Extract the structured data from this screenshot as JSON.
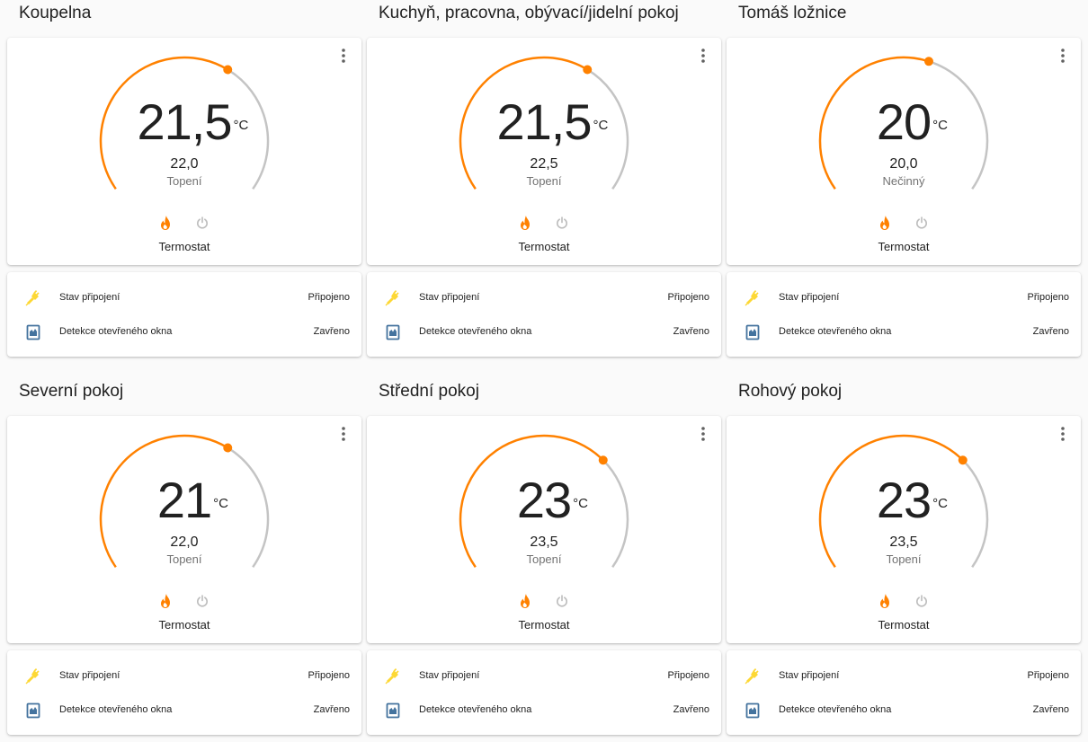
{
  "colors": {
    "heat": "#ff8100",
    "arc_inactive": "#c4c4c4",
    "plug_icon": "#fdd835",
    "window_icon": "#44739e",
    "off_icon": "#bdbdbd"
  },
  "icons": {
    "menu": "dots-vertical-icon",
    "heat": "fire-icon",
    "off": "power-icon",
    "connection": "plug-icon",
    "window": "window-closed-icon"
  },
  "rooms": [
    {
      "title": "Koupelna",
      "current": "21,5",
      "unit": "°C",
      "target": "22,0",
      "action": "Topení",
      "name": "Termostat",
      "gauge_fraction": 0.625,
      "entities": [
        {
          "label": "Stav připojení",
          "value": "Připojeno"
        },
        {
          "label": "Detekce otevřeného okna",
          "value": "Zavřeno"
        }
      ]
    },
    {
      "title": "Kuchyň, pracovna, obývací/jidelní pokoj",
      "current": "21,5",
      "unit": "°C",
      "target": "22,5",
      "action": "Topení",
      "name": "Termostat",
      "gauge_fraction": 0.625,
      "entities": [
        {
          "label": "Stav připojení",
          "value": "Připojeno"
        },
        {
          "label": "Detekce otevřeného okna",
          "value": "Zavřeno"
        }
      ]
    },
    {
      "title": "Tomáš ložnice",
      "current": "20",
      "unit": "°C",
      "target": "20,0",
      "action": "Nečinný",
      "name": "Termostat",
      "gauge_fraction": 0.57,
      "entities": [
        {
          "label": "Stav připojení",
          "value": "Připojeno"
        },
        {
          "label": "Detekce otevřeného okna",
          "value": "Zavřeno"
        }
      ]
    },
    {
      "title": "Severní pokoj",
      "current": "21",
      "unit": "°C",
      "target": "22,0",
      "action": "Topení",
      "name": "Termostat",
      "gauge_fraction": 0.625,
      "entities": [
        {
          "label": "Stav připojení",
          "value": "Připojeno"
        },
        {
          "label": "Detekce otevřeného okna",
          "value": "Zavřeno"
        }
      ]
    },
    {
      "title": "Střední pokoj",
      "current": "23",
      "unit": "°C",
      "target": "23,5",
      "action": "Topení",
      "name": "Termostat",
      "gauge_fraction": 0.68,
      "entities": [
        {
          "label": "Stav připojení",
          "value": "Připojeno"
        },
        {
          "label": "Detekce otevřeného okna",
          "value": "Zavřeno"
        }
      ]
    },
    {
      "title": "Rohový pokoj",
      "current": "23",
      "unit": "°C",
      "target": "23,5",
      "action": "Topení",
      "name": "Termostat",
      "gauge_fraction": 0.68,
      "entities": [
        {
          "label": "Stav připojení",
          "value": "Připojeno"
        },
        {
          "label": "Detekce otevřeného okna",
          "value": "Zavřeno"
        }
      ]
    }
  ]
}
